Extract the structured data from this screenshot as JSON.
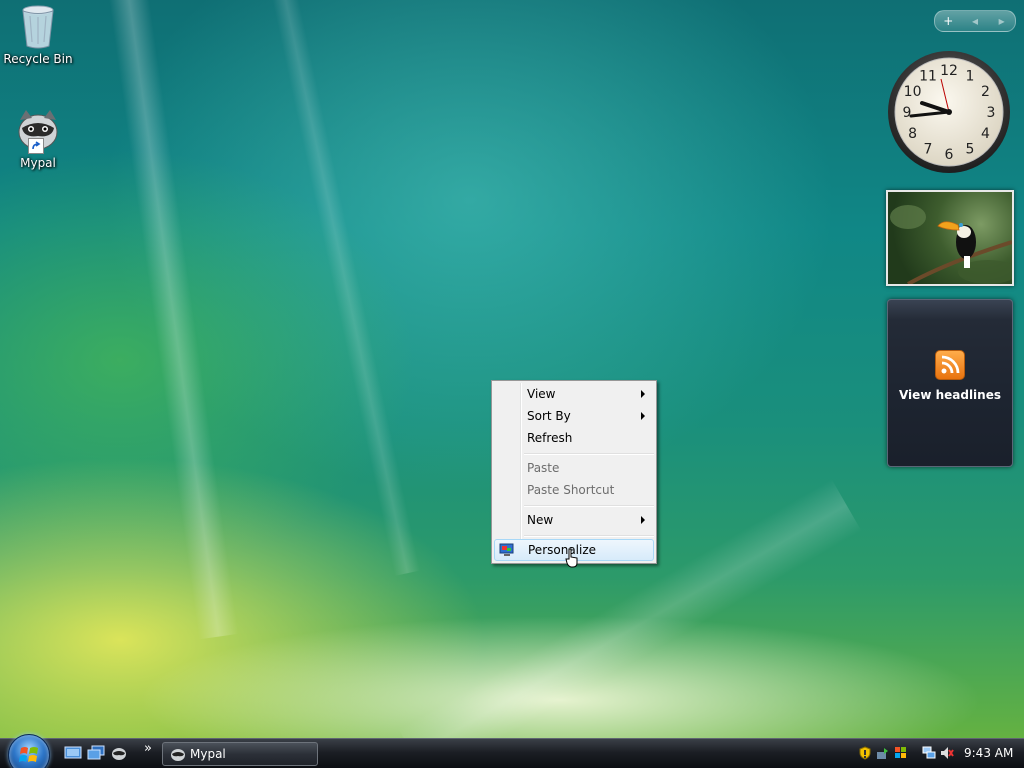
{
  "desktop": {
    "icons": [
      {
        "label": "Recycle Bin"
      },
      {
        "label": "Mypal"
      }
    ]
  },
  "sidebar": {
    "controls": [
      "+",
      "◂",
      "▸"
    ],
    "clock": {
      "numerals": [
        "12",
        "1",
        "2",
        "3",
        "4",
        "5",
        "6",
        "7",
        "8",
        "9",
        "10",
        "11"
      ]
    },
    "feed": {
      "label": "View headlines"
    }
  },
  "context_menu": {
    "items": [
      {
        "label": "View"
      },
      {
        "label": "Sort By"
      },
      {
        "label": "Refresh"
      },
      {
        "label": "Paste"
      },
      {
        "label": "Paste Shortcut"
      },
      {
        "label": "New"
      },
      {
        "label": "Personalize"
      }
    ]
  },
  "taskbar": {
    "overflow": "»",
    "task_label": "Mypal",
    "time": "9:43 AM"
  },
  "colors": {
    "menu_bg": "#f0f0f0",
    "menu_hover": "#d7ebfa",
    "taskbar_bg": "#1b1e24",
    "rss_orange": "#f08a24"
  }
}
